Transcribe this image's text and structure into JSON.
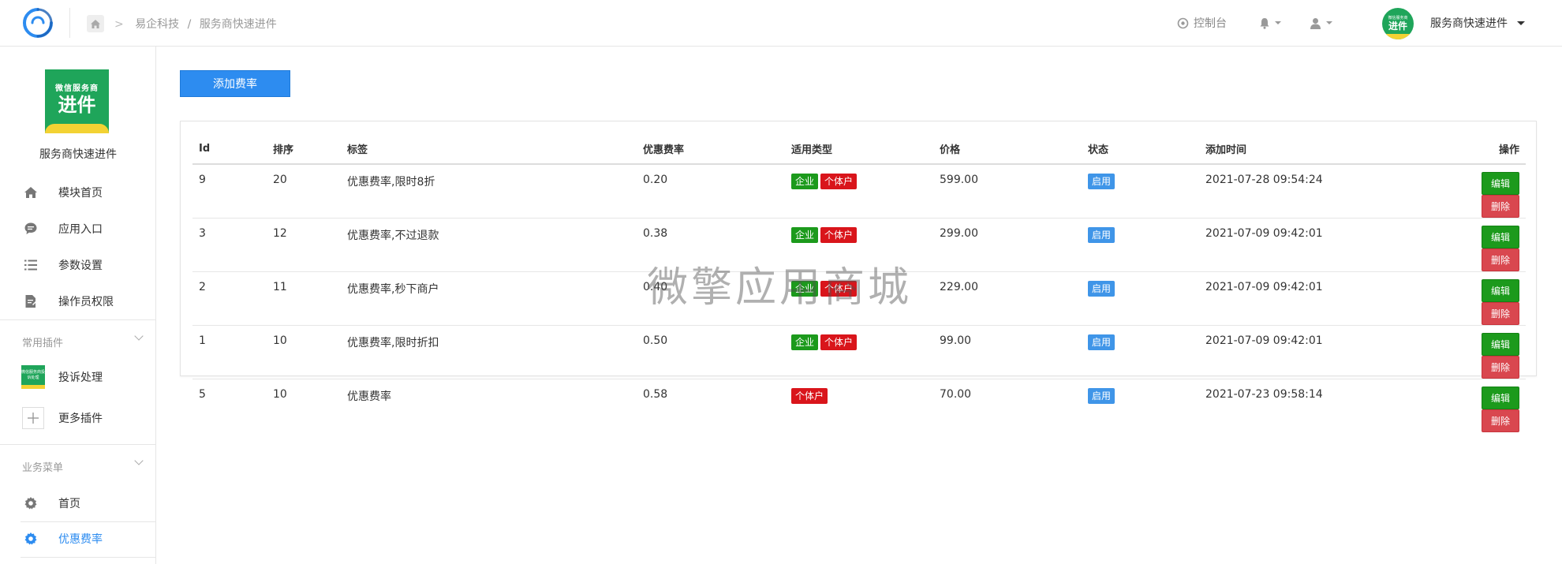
{
  "breadcrumb": {
    "items": [
      "易企科技",
      "/",
      "服务商快速进件"
    ]
  },
  "topbar": {
    "console_label": "控制台",
    "account_name": "服务商快速进件",
    "avatar": {
      "line1": "微信服务商",
      "line2": "进件"
    }
  },
  "sidebar": {
    "app_logo": {
      "line1": "微信服务商",
      "line2": "进件"
    },
    "app_name": "服务商快速进件",
    "main_items": [
      {
        "label": "模块首页",
        "icon": "home-icon"
      },
      {
        "label": "应用入口",
        "icon": "chat-icon"
      },
      {
        "label": "参数设置",
        "icon": "list-icon"
      },
      {
        "label": "操作员权限",
        "icon": "doc-edit-icon"
      }
    ],
    "group_plugins": {
      "title": "常用插件",
      "items": [
        {
          "label": "投诉处理",
          "thumb": "微信服务商投诉处理"
        },
        {
          "label": "更多插件",
          "icon": "plus-icon"
        }
      ]
    },
    "group_business": {
      "title": "业务菜单",
      "items": [
        {
          "label": "首页",
          "icon": "gear-icon"
        },
        {
          "label": "优惠费率",
          "icon": "gear-icon",
          "active": true
        }
      ]
    }
  },
  "toolbar": {
    "add_label": "添加费率"
  },
  "table": {
    "headers": [
      "Id",
      "排序",
      "标签",
      "优惠费率",
      "适用类型",
      "价格",
      "状态",
      "添加时间",
      "操作"
    ],
    "rows": [
      {
        "id": "9",
        "sort": "20",
        "label": "优惠费率,限时8折",
        "rate": "0.20",
        "types": [
          "企业",
          "个体户"
        ],
        "price": "599.00",
        "status": "启用",
        "added": "2021-07-28 09:54:24"
      },
      {
        "id": "3",
        "sort": "12",
        "label": "优惠费率,不过退款",
        "rate": "0.38",
        "types": [
          "企业",
          "个体户"
        ],
        "price": "299.00",
        "status": "启用",
        "added": "2021-07-09 09:42:01"
      },
      {
        "id": "2",
        "sort": "11",
        "label": "优惠费率,秒下商户",
        "rate": "0.40",
        "types": [
          "企业",
          "个体户"
        ],
        "price": "229.00",
        "status": "启用",
        "added": "2021-07-09 09:42:01"
      },
      {
        "id": "1",
        "sort": "10",
        "label": "优惠费率,限时折扣",
        "rate": "0.50",
        "types": [
          "企业",
          "个体户"
        ],
        "price": "99.00",
        "status": "启用",
        "added": "2021-07-09 09:42:01"
      },
      {
        "id": "5",
        "sort": "10",
        "label": "优惠费率",
        "rate": "0.58",
        "types": [
          "个体户"
        ],
        "price": "70.00",
        "status": "启用",
        "added": "2021-07-23 09:58:14"
      }
    ],
    "row_actions": {
      "edit": "编辑",
      "delete": "删除"
    }
  },
  "watermark": "微擎应用商城",
  "colors": {
    "primary": "#2d8cf0",
    "success": "#1c9a1c",
    "danger": "#d9151b",
    "delete": "#d9474f",
    "brand_green": "#1fa55a"
  }
}
